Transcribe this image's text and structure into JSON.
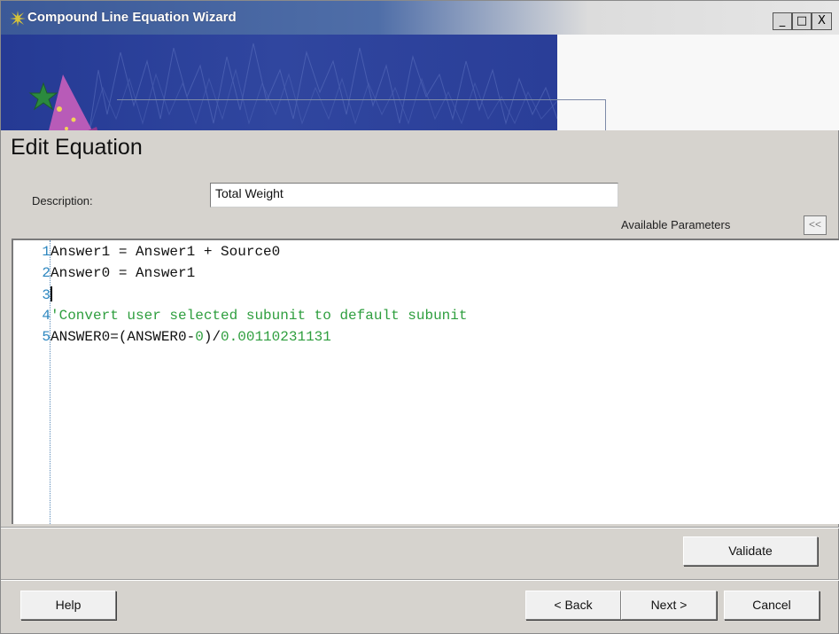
{
  "window": {
    "title": "Compound Line Equation Wizard",
    "controls": [
      "_",
      "□",
      "X"
    ]
  },
  "page": {
    "heading": "Edit Equation"
  },
  "form": {
    "description_label": "Description:",
    "description_value": "Total Weight",
    "available_parameters_label": "Available Parameters",
    "collapse_label": "<<"
  },
  "editor": {
    "lines": [
      {
        "n": "1",
        "text": "Answer1 = Answer1 + Source0"
      },
      {
        "n": "2",
        "text": "Answer0 = Answer1"
      },
      {
        "n": "3",
        "text": ""
      },
      {
        "n": "4",
        "text": "'Convert user selected subunit to default subunit"
      },
      {
        "n": "5",
        "pre": "ANSWER0=(ANSWER0-",
        "n1": "0",
        "mid": ")/",
        "n2": "0.00110231131"
      }
    ]
  },
  "buttons": {
    "validate": "Validate",
    "help": "Help",
    "back": "< Back",
    "next": "Next >",
    "cancel": "Cancel"
  },
  "colors": {
    "titlebar": "#3b5998",
    "banner": "#2a3f9c",
    "line_number": "#2c86bf",
    "comment_green": "#2e9e3e"
  }
}
